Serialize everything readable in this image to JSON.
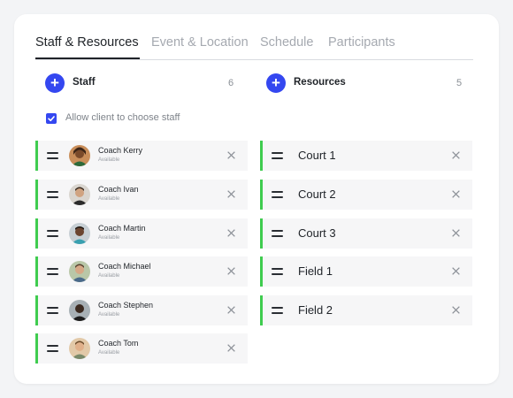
{
  "tabs": [
    {
      "label": "Staff & Resources",
      "active": true
    },
    {
      "label": "Event & Location",
      "active": false
    },
    {
      "label": "Schedule",
      "active": false
    },
    {
      "label": "Participants",
      "active": false
    }
  ],
  "staff": {
    "title": "Staff",
    "count": "6",
    "allow_label": "Allow client to choose staff",
    "allow_checked": true,
    "items": [
      {
        "name": "Coach Kerry",
        "status": "Available"
      },
      {
        "name": "Coach Ivan",
        "status": "Available"
      },
      {
        "name": "Coach Martin",
        "status": "Available"
      },
      {
        "name": "Coach Michael",
        "status": "Available"
      },
      {
        "name": "Coach Stephen",
        "status": "Available"
      },
      {
        "name": "Coach Tom",
        "status": "Available"
      }
    ]
  },
  "resources": {
    "title": "Resources",
    "count": "5",
    "items": [
      {
        "name": "Court 1"
      },
      {
        "name": "Court 2"
      },
      {
        "name": "Court 3"
      },
      {
        "name": "Field 1"
      },
      {
        "name": "Field 2"
      }
    ]
  },
  "colors": {
    "accent": "#3447f0",
    "active_bar": "#3fcc4f",
    "item_bg": "#f6f6f7"
  },
  "icons": {
    "add": "plus-icon",
    "drag": "drag-handle-icon",
    "remove": "close-icon",
    "check": "check-icon"
  }
}
